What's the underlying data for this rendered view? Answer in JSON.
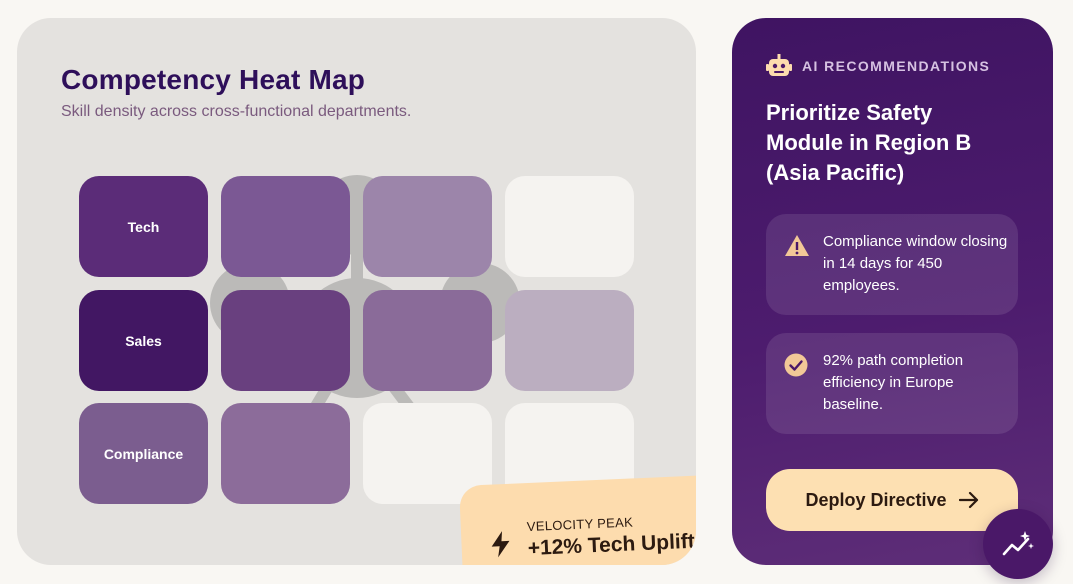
{
  "heatmap": {
    "title": "Competency Heat Map",
    "subtitle": "Skill density across cross-functional departments.",
    "row_labels": [
      "Tech",
      "Sales",
      "Compliance"
    ],
    "cell_colors": [
      [
        "#5b2c78",
        "#7b5894",
        "#9c85aa",
        "#f5f3f0"
      ],
      [
        "#421763",
        "#69407f",
        "#8a6b99",
        "#bbaec0"
      ],
      [
        "#7b5d8f",
        "#8c6c9a",
        "#f5f3f0",
        "#f5f3f0"
      ]
    ]
  },
  "velocity": {
    "label": "VELOCITY PEAK",
    "value": "+12% Tech Uplift"
  },
  "ai": {
    "header_label": "AI RECOMMENDATIONS",
    "title": "Prioritize Safety Module in Region B (Asia Pacific)",
    "insights": [
      {
        "icon": "warning-icon",
        "text": "Compliance window closing in 14 days for 450 employees."
      },
      {
        "icon": "check-circle-icon",
        "text": "92% path completion efficiency in Europe baseline."
      }
    ],
    "deploy_label": "Deploy Directive"
  },
  "colors": {
    "accent_purple": "#4a1868",
    "accent_peach": "#fde0b2",
    "title_color": "#2e0f5a"
  }
}
